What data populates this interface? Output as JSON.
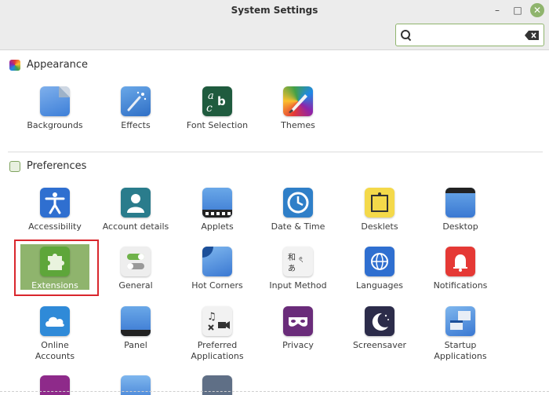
{
  "window": {
    "title": "System Settings",
    "minimize": "–",
    "maximize": "□",
    "close": "✕"
  },
  "search": {
    "value": "",
    "placeholder": ""
  },
  "sections": [
    {
      "title": "Appearance",
      "items": [
        {
          "label": "Backgrounds"
        },
        {
          "label": "Effects"
        },
        {
          "label": "Font Selection"
        },
        {
          "label": "Themes"
        }
      ]
    },
    {
      "title": "Preferences",
      "items": [
        {
          "label": "Accessibility"
        },
        {
          "label": "Account details"
        },
        {
          "label": "Applets"
        },
        {
          "label": "Date & Time"
        },
        {
          "label": "Desklets"
        },
        {
          "label": "Desktop"
        },
        {
          "label": "Extensions",
          "selected": true
        },
        {
          "label": "General"
        },
        {
          "label": "Hot Corners"
        },
        {
          "label": "Input Method"
        },
        {
          "label": "Languages"
        },
        {
          "label": "Notifications"
        },
        {
          "label": "Online\nAccounts"
        },
        {
          "label": "Panel"
        },
        {
          "label": "Preferred\nApplications"
        },
        {
          "label": "Privacy"
        },
        {
          "label": "Screensaver"
        },
        {
          "label": "Startup\nApplications"
        }
      ]
    }
  ],
  "colors": {
    "accent": "#8fb46d",
    "highlight_border": "#d9262d"
  }
}
